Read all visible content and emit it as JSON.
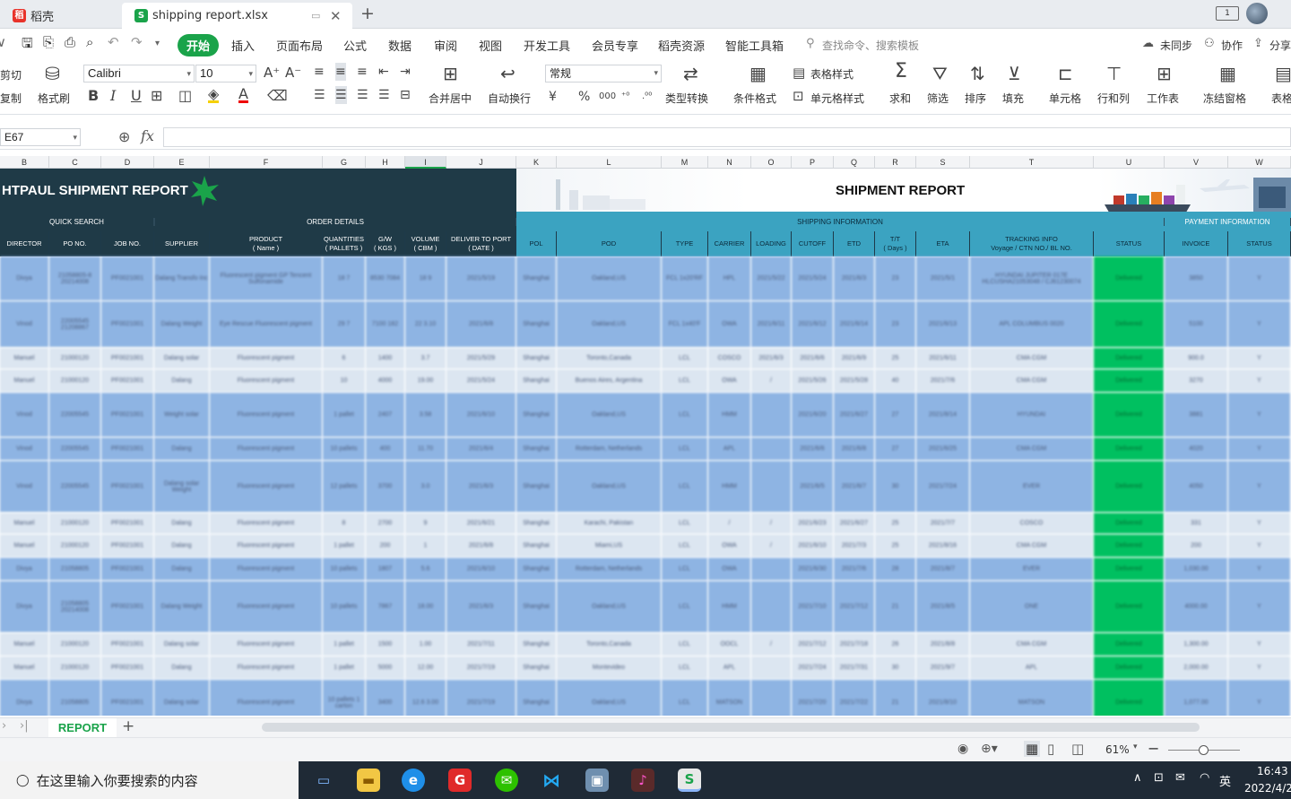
{
  "tabs": [
    {
      "label": "稻壳",
      "active": false
    },
    {
      "label": "shipping report.xlsx",
      "active": true
    }
  ],
  "menu": {
    "start": "开始",
    "items": [
      "插入",
      "页面布局",
      "公式",
      "数据",
      "审阅",
      "视图",
      "开发工具",
      "会员专享",
      "稻壳资源",
      "智能工具箱"
    ],
    "search_placeholder": "查找命令、搜索模板",
    "unsync": "未同步",
    "collab": "协作",
    "share": "分享"
  },
  "ribbon": {
    "cut": "剪切",
    "copy": "复制",
    "format_painter": "格式刷",
    "font_name": "Calibri",
    "font_size": "10",
    "merge_center": "合并居中",
    "wrap": "自动换行",
    "number_format": "常规",
    "type_convert": "类型转换",
    "cond_format": "条件格式",
    "table_style": "表格样式",
    "cell_style": "单元格样式",
    "sum": "求和",
    "filter": "筛选",
    "sort": "排序",
    "fill": "填充",
    "cell": "单元格",
    "rowcol": "行和列",
    "worksheet": "工作表",
    "freeze": "冻结窗格",
    "table_tools": "表格"
  },
  "formula": {
    "cell_ref": "E67",
    "fx": "fx",
    "value": ""
  },
  "columns": [
    "B",
    "C",
    "D",
    "E",
    "F",
    "G",
    "H",
    "I",
    "J",
    "K",
    "L",
    "M",
    "N",
    "O",
    "P",
    "Q",
    "R",
    "S",
    "T",
    "U",
    "V",
    "W"
  ],
  "report": {
    "title_left": "HTPAUL SHIPMENT REPORT",
    "title_right": "SHIPMENT REPORT",
    "sections": {
      "quick": "QUICK SEARCH",
      "order": "ORDER DETAILS",
      "shipping": "SHIPPING INFORMATION",
      "payment": "PAYMENT INFORMATION"
    },
    "headers": [
      "DIRECTOR",
      "PO NO.",
      "JOB NO.",
      "SUPPLIER",
      "PRODUCT\n( Name )",
      "QUANTITIES\n( PALLETS )",
      "G/W\n( KGS )",
      "VOLUME\n( CBM )",
      "DELIVER TO PORT\n( DATE )",
      "POL",
      "POD",
      "TYPE",
      "CARRIER",
      "LOADING",
      "CUTOFF",
      "ETD",
      "T/T\n( Days )",
      "ETA",
      "TRACKING INFO\nVoyage / CTN NO./ BL NO.",
      "STATUS",
      "INVOICE",
      "STATUS"
    ],
    "rows": [
      [
        "Divya",
        "21058805-8 20214008",
        "PF0021001",
        "Dalang Transfo Inc",
        "Fluorescent pigment GP Tencent Sulfonamide",
        "18 7",
        "8530 7084",
        "18 9",
        "2021/5/19",
        "Shanghai",
        "Oakland,US",
        "FCL 1x20'RF",
        "HPL",
        "2021/5/22",
        "2021/5/24",
        "2021/6/3",
        "23",
        "2021/5/1",
        "HYUNDAI JUPITER 017E HLCUSHA21053048 / CJ61230074",
        "Delivered",
        "3850",
        "Y"
      ],
      [
        "Vinod",
        "22005545 21208867",
        "PF0021001",
        "Dalang Weight",
        "Eye Rescue Fluorescent pigment",
        "29 7",
        "7100 182",
        "22 3.10",
        "2021/6/8",
        "Shanghai",
        "Oakland,US",
        "FCL 1x40'F",
        "OWA",
        "2021/6/11",
        "2021/6/12",
        "2021/6/14",
        "23",
        "2021/6/13",
        "APL COLUMBUS 0020",
        "Delivered",
        "5100",
        "Y"
      ],
      [
        "Manuel",
        "21000120",
        "PF0021001",
        "Dalang solar",
        "Fluorescent pigment",
        "6",
        "1400",
        "3.7",
        "2021/5/29",
        "Shanghai",
        "Toronto,Canada",
        "LCL",
        "COSCO",
        "2021/6/3",
        "2021/6/6",
        "2021/6/9",
        "25",
        "2021/6/11",
        "CMA CGM",
        "Delivered",
        "900.0",
        "Y"
      ],
      [
        "Manuel",
        "21000120",
        "PF0021001",
        "Dalang",
        "Fluorescent pigment",
        "10",
        "4000",
        "19.00",
        "2021/5/24",
        "Shanghai",
        "Buenos Aires, Argentina",
        "LCL",
        "OWA",
        "/",
        "2021/5/26",
        "2021/5/28",
        "40",
        "2021/7/6",
        "CMA CGM",
        "Delivered",
        "3270",
        "Y"
      ],
      [
        "Vinod",
        "22005545",
        "PF0021001",
        "Weight solar",
        "Fluorescent pigment",
        "1 pallet",
        "2407",
        "3.58",
        "2021/6/10",
        "Shanghai",
        "Oakland,US",
        "LCL",
        "HMM",
        "",
        "2021/6/20",
        "2021/6/27",
        "27",
        "2021/8/14",
        "HYUNDAI",
        "Delivered",
        "3881",
        "Y"
      ],
      [
        "Vinod",
        "22005545",
        "PF0021001",
        "Dalang",
        "Fluorescent pigment",
        "10 pallets",
        "400",
        "11.70",
        "2021/6/4",
        "Shanghai",
        "Rotterdam, Netherlands",
        "LCL",
        "APL",
        "",
        "2021/6/6",
        "2021/6/8",
        "27",
        "2021/6/25",
        "CMA CGM",
        "Delivered",
        "4020",
        "Y"
      ],
      [
        "Vinod",
        "22005545",
        "PF0021001",
        "Dalang solar Weight",
        "Fluorescent pigment",
        "12 pallets",
        "3700",
        "3.0",
        "2021/6/3",
        "Shanghai",
        "Oakland,US",
        "LCL",
        "HMM",
        "",
        "2021/6/5",
        "2021/6/7",
        "30",
        "2021/7/24",
        "EVER",
        "Delivered",
        "4050",
        "Y"
      ],
      [
        "Manuel",
        "21000120",
        "PF0021001",
        "Dalang",
        "Fluorescent pigment",
        "8",
        "2700",
        "9",
        "2021/6/21",
        "Shanghai",
        "Karachi, Pakistan",
        "LCL",
        "/",
        "/",
        "2021/6/23",
        "2021/6/27",
        "25",
        "2021/7/7",
        "COSCO",
        "Delivered",
        "331",
        "Y"
      ],
      [
        "Manuel",
        "21000120",
        "PF0021001",
        "Dalang",
        "Fluorescent pigment",
        "1 pallet",
        "200",
        "1",
        "2021/6/8",
        "Shanghai",
        "Miami,US",
        "LCL",
        "OWA",
        "/",
        "2021/6/10",
        "2021/7/3",
        "25",
        "2021/8/16",
        "CMA CGM",
        "Delivered",
        "200",
        "Y"
      ],
      [
        "Divya",
        "21058805",
        "PF0021001",
        "Dalang",
        "Fluorescent pigment",
        "10 pallets",
        "1807",
        "5.6",
        "2021/6/10",
        "Shanghai",
        "Rotterdam, Netherlands",
        "LCL",
        "OWA",
        "",
        "2021/6/30",
        "2021/7/6",
        "28",
        "2021/8/7",
        "EVER",
        "Delivered",
        "1,030.00",
        "Y"
      ],
      [
        "Divya",
        "21058805 20214008",
        "PF0021001",
        "Dalang Weight",
        "Fluorescent pigment",
        "10 pallets",
        "7867",
        "18.00",
        "2021/6/3",
        "Shanghai",
        "Oakland,US",
        "LCL",
        "HMM",
        "",
        "2021/7/10",
        "2021/7/12",
        "21",
        "2021/8/5",
        "ONE",
        "Delivered",
        "4000.00",
        "Y"
      ],
      [
        "Manuel",
        "21000120",
        "PF0021001",
        "Dalang solar",
        "Fluorescent pigment",
        "1 pallet",
        "1500",
        "1.00",
        "2021/7/11",
        "Shanghai",
        "Toronto,Canada",
        "LCL",
        "OOCL",
        "/",
        "2021/7/12",
        "2021/7/18",
        "26",
        "2021/8/8",
        "CMA CGM",
        "Delivered",
        "1,300.00",
        "Y"
      ],
      [
        "Manuel",
        "21000120",
        "PF0021001",
        "Dalang",
        "Fluorescent pigment",
        "1 pallet",
        "5000",
        "12.00",
        "2021/7/19",
        "Shanghai",
        "Montevideo",
        "LCL",
        "APL",
        "",
        "2021/7/24",
        "2021/7/31",
        "30",
        "2021/9/7",
        "APL",
        "Delivered",
        "2,000.00",
        "Y"
      ],
      [
        "Divya",
        "21058805",
        "PF0021001",
        "Dalang solar",
        "Fluorescent pigment",
        "10 pallets 1 carton",
        "3400",
        "12.6 3.00",
        "2021/7/19",
        "Shanghai",
        "Oakland,US",
        "LCL",
        "MATSON",
        "",
        "2021/7/20",
        "2021/7/22",
        "21",
        "2021/8/10",
        "MATSON",
        "Delivered",
        "1,077.00",
        "Y"
      ]
    ]
  },
  "sheet_tab": "REPORT",
  "status": {
    "zoom": "61%"
  },
  "taskbar": {
    "search": "在这里输入你要搜索的内容",
    "time": "16:43",
    "date": "2022/4/2",
    "ime": "英"
  },
  "colors": {
    "dark_header": "#1f3a47",
    "teal": "#3ba3c1",
    "row_blue": "#8eb4e3",
    "row_light": "#dce6f1",
    "green": "#00c060"
  }
}
